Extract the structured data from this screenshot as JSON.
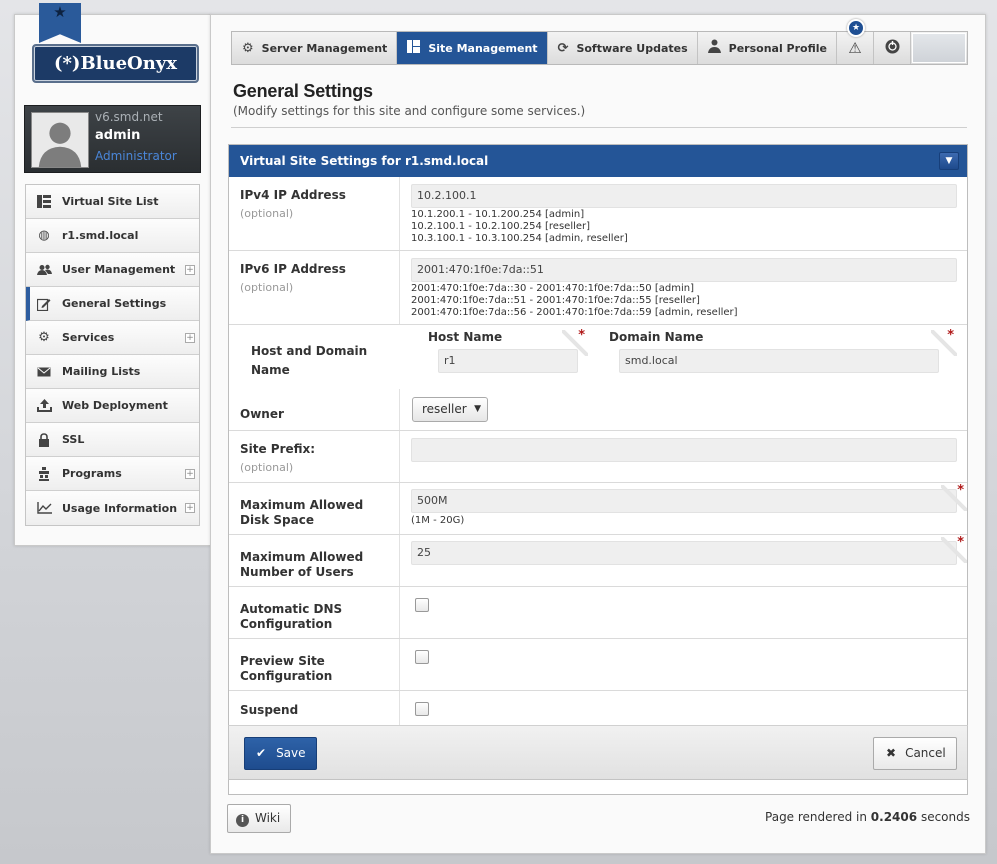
{
  "brand": {
    "logo_text": "(*)BlueOnyx"
  },
  "user": {
    "host": "v6.smd.net",
    "name": "admin",
    "role": "Administrator"
  },
  "sidebar": {
    "items": [
      {
        "label": "Virtual Site List",
        "icon": "list-icon",
        "expandable": false
      },
      {
        "label": "r1.smd.local",
        "icon": "globe-icon",
        "expandable": false
      },
      {
        "label": "User Management",
        "icon": "users-icon",
        "expandable": true
      },
      {
        "label": "General Settings",
        "icon": "edit-icon",
        "expandable": false,
        "active": true
      },
      {
        "label": "Services",
        "icon": "gear-icon",
        "expandable": true
      },
      {
        "label": "Mailing Lists",
        "icon": "envelope-icon",
        "expandable": false
      },
      {
        "label": "Web Deployment",
        "icon": "upload-icon",
        "expandable": false
      },
      {
        "label": "SSL",
        "icon": "lock-icon",
        "expandable": false
      },
      {
        "label": "Programs",
        "icon": "programs-icon",
        "expandable": true
      },
      {
        "label": "Usage Information",
        "icon": "chart-icon",
        "expandable": true
      }
    ]
  },
  "tabs": [
    {
      "label": "Server Management",
      "icon": "gear-icon"
    },
    {
      "label": "Site Management",
      "icon": "grid-icon",
      "active": true
    },
    {
      "label": "Software Updates",
      "icon": "refresh-icon"
    },
    {
      "label": "Personal Profile",
      "icon": "person-icon"
    }
  ],
  "page": {
    "title": "General Settings",
    "subtitle": "(Modify settings for this site and configure some services.)"
  },
  "panel": {
    "title": "Virtual Site Settings for r1.smd.local"
  },
  "form": {
    "ipv4": {
      "label": "IPv4 IP Address",
      "optional": "(optional)",
      "value": "10.2.100.1",
      "hint": "10.1.200.1 - 10.1.200.254 [admin]\n10.2.100.1 - 10.2.100.254 [reseller]\n10.3.100.1 - 10.3.100.254 [admin, reseller]"
    },
    "ipv6": {
      "label": "IPv6 IP Address",
      "optional": "(optional)",
      "value": "2001:470:1f0e:7da::51",
      "hint": "2001:470:1f0e:7da::30 - 2001:470:1f0e:7da::50 [admin]\n2001:470:1f0e:7da::51 - 2001:470:1f0e:7da::55 [reseller]\n2001:470:1f0e:7da::56 - 2001:470:1f0e:7da::59 [admin, reseller]"
    },
    "hostdomain": {
      "label": "Host and Domain Name",
      "host_label": "Host Name",
      "host_value": "r1",
      "domain_label": "Domain Name",
      "domain_value": "smd.local"
    },
    "owner": {
      "label": "Owner",
      "value": "reseller"
    },
    "prefix": {
      "label": "Site Prefix:",
      "optional": "(optional)",
      "value": ""
    },
    "disk": {
      "label": "Maximum Allowed Disk Space",
      "value": "500M",
      "hint": "(1M - 20G)"
    },
    "users": {
      "label": "Maximum Allowed Number of Users",
      "value": "25"
    },
    "dns": {
      "label": "Automatic DNS Configuration",
      "checked": false
    },
    "preview": {
      "label": "Preview Site Configuration",
      "checked": false
    },
    "suspend": {
      "label": "Suspend",
      "checked": false
    }
  },
  "buttons": {
    "save": "Save",
    "cancel": "Cancel",
    "wiki": "Wiki"
  },
  "footer": {
    "prefix": "Page rendered in",
    "time": "0.2406",
    "suffix": "seconds"
  },
  "colors": {
    "accent": "#245597",
    "required": "#b01919"
  }
}
